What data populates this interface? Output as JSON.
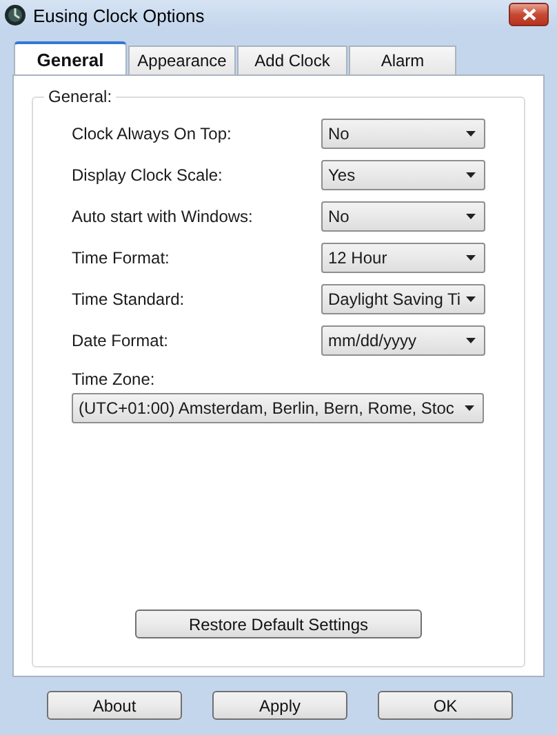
{
  "window": {
    "title": "Eusing Clock Options"
  },
  "tabs": [
    {
      "label": "General",
      "selected": true
    },
    {
      "label": "Appearance",
      "selected": false
    },
    {
      "label": "Add Clock",
      "selected": false
    },
    {
      "label": "Alarm",
      "selected": false
    }
  ],
  "group": {
    "title": "General:"
  },
  "settings": [
    {
      "label": "Clock Always On Top:",
      "value": "No"
    },
    {
      "label": "Display Clock Scale:",
      "value": "Yes"
    },
    {
      "label": "Auto start with Windows:",
      "value": "No"
    },
    {
      "label": "Time Format:",
      "value": "12 Hour"
    },
    {
      "label": "Time Standard:",
      "value": "Daylight Saving Ti"
    },
    {
      "label": "Date Format:",
      "value": "mm/dd/yyyy"
    }
  ],
  "time_zone": {
    "label": "Time Zone:",
    "value": "(UTC+01:00) Amsterdam, Berlin, Bern, Rome, Stoc"
  },
  "restore_button": "Restore Default Settings",
  "buttons": [
    "About",
    "Apply",
    "OK"
  ]
}
